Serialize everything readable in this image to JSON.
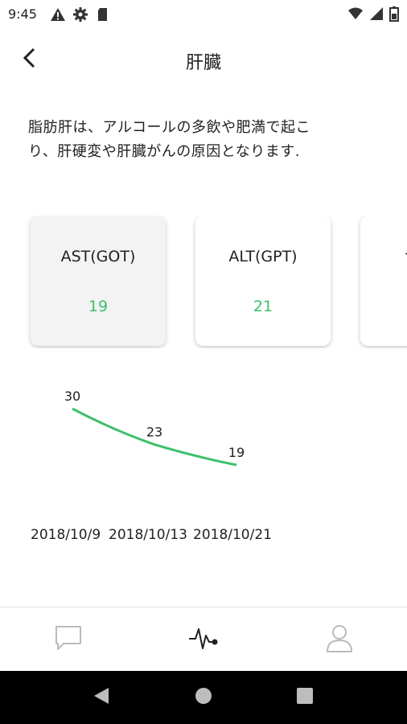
{
  "status_bar": {
    "time": "9:45",
    "left_icons": [
      "warning-icon",
      "gear-icon",
      "sd-card-icon"
    ],
    "right_icons": [
      "wifi-icon",
      "signal-icon",
      "battery-icon"
    ]
  },
  "header": {
    "title": "肝臓",
    "back_icon": "chevron-left-icon"
  },
  "description": {
    "line1": "脂肪肝は、アルコールの多飲や肥満で起こ",
    "line2": "り、肝硬変や肝臓がんの原因となります."
  },
  "cards": [
    {
      "label": "AST(GOT)",
      "value": "19",
      "selected": true
    },
    {
      "label": "ALT(GPT)",
      "value": "21",
      "selected": false
    },
    {
      "label": "γ",
      "value": "",
      "selected": false
    }
  ],
  "colors": {
    "accent": "#3cc06a",
    "text": "#222222",
    "card_selected_bg": "#f3f3f3"
  },
  "chart_data": {
    "type": "line",
    "x": [
      "2018/10/9",
      "2018/10/13",
      "2018/10/21"
    ],
    "values": [
      30,
      23,
      19
    ],
    "color": "#3cc06a",
    "grid": false
  },
  "bottom_nav": [
    {
      "icon": "chat-bubble-icon",
      "active": false
    },
    {
      "icon": "heartbeat-icon",
      "active": true
    },
    {
      "icon": "profile-icon",
      "active": false
    }
  ],
  "system_nav": [
    "back-triangle-icon",
    "home-circle-icon",
    "recents-square-icon"
  ]
}
